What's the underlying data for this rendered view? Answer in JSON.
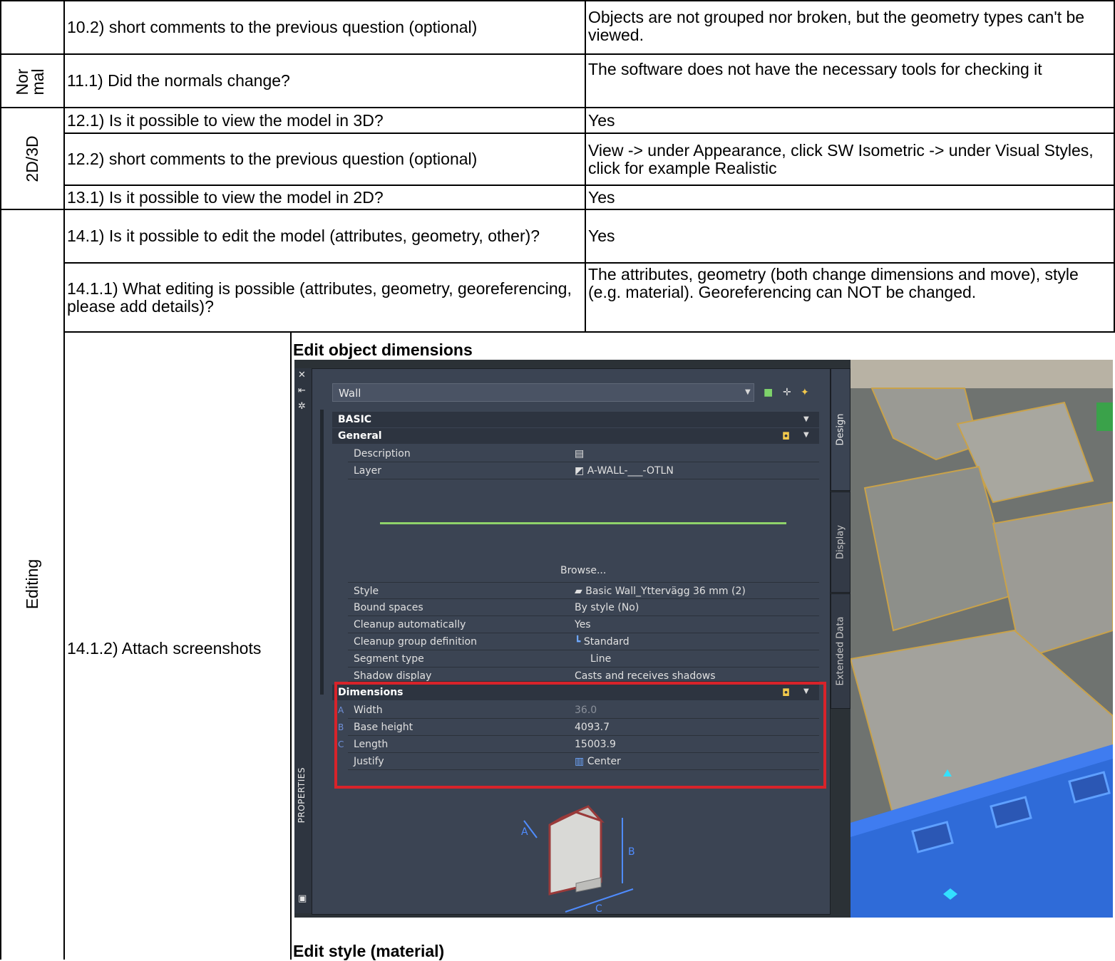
{
  "rows": [
    {
      "question": "10.2) short comments to the previous question (optional)",
      "answer": "Objects are not grouped nor broken, but the geometry types can't be viewed."
    },
    {
      "question": "11.1) Did the normals change?",
      "answer": "The software does not have the necessary tools for checking it"
    },
    {
      "question": "12.1) Is it possible to view the model in 3D?",
      "answer": "Yes"
    },
    {
      "question": "12.2) short comments to the previous question (optional)",
      "answer": "View -> under Appearance, click SW Isometric -> under Visual Styles, click for example Realistic"
    },
    {
      "question": "13.1) Is it possible to view the model in 2D?",
      "answer": "Yes"
    },
    {
      "question": "14.1) Is it possible to edit the model (attributes, geometry, other)?",
      "answer": "Yes"
    },
    {
      "question": "14.1.1) What editing is possible (attributes, geometry, georeferencing, please add details)?",
      "answer": "The attributes, geometry (both change dimensions and move), style (e.g. material). Georeferencing can NOT be changed."
    },
    {
      "question": "14.1.2) Attach screenshots",
      "answer": ""
    }
  ],
  "categories": {
    "normal": "Nor mal",
    "view": "2D/3D",
    "editing": "Editing"
  },
  "screenshots": {
    "caption1": "Edit object dimensions",
    "caption2": "Edit style (material)"
  },
  "properties_panel": {
    "object_type": "Wall",
    "basic_label": "BASIC",
    "general_label": "General",
    "general_rows": [
      {
        "key": "Description",
        "value": "▤"
      },
      {
        "key": "Layer",
        "value": "A-WALL-___-OTLN"
      }
    ],
    "browse_label": "Browse...",
    "style_rows": [
      {
        "key": "Style",
        "value": "Basic Wall_Yttervägg 36 mm (2)"
      },
      {
        "key": "Bound spaces",
        "value": "By style (No)"
      },
      {
        "key": "Cleanup automatically",
        "value": "Yes"
      },
      {
        "key": "Cleanup group definition",
        "value": "Standard"
      },
      {
        "key": "Segment type",
        "value": "Line"
      },
      {
        "key": "Shadow display",
        "value": "Casts and receives shadows"
      }
    ],
    "dimensions_label": "Dimensions",
    "dimension_rows": [
      {
        "letter": "A",
        "key": "Width",
        "value": "36.0"
      },
      {
        "letter": "B",
        "key": "Base height",
        "value": "4093.7"
      },
      {
        "letter": "C",
        "key": "Length",
        "value": "15003.9"
      },
      {
        "letter": "",
        "key": "Justify",
        "value": "Center"
      }
    ],
    "tabs": [
      "Design",
      "Display",
      "Extended Data"
    ],
    "palette_title": "PROPERTIES",
    "diagram_labels": [
      "A",
      "B",
      "C"
    ]
  }
}
